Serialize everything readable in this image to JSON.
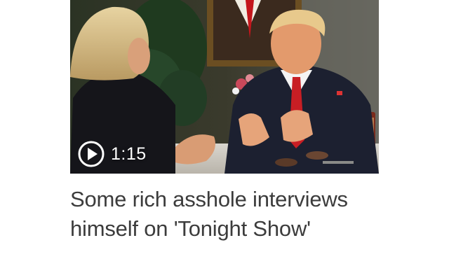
{
  "video": {
    "duration": "1:15",
    "play_icon": "play-icon",
    "headline": "Some rich asshole interviews himself on 'Tonight Show'"
  },
  "colors": {
    "headline_text": "#3c3c3c",
    "overlay_text": "#ffffff"
  }
}
